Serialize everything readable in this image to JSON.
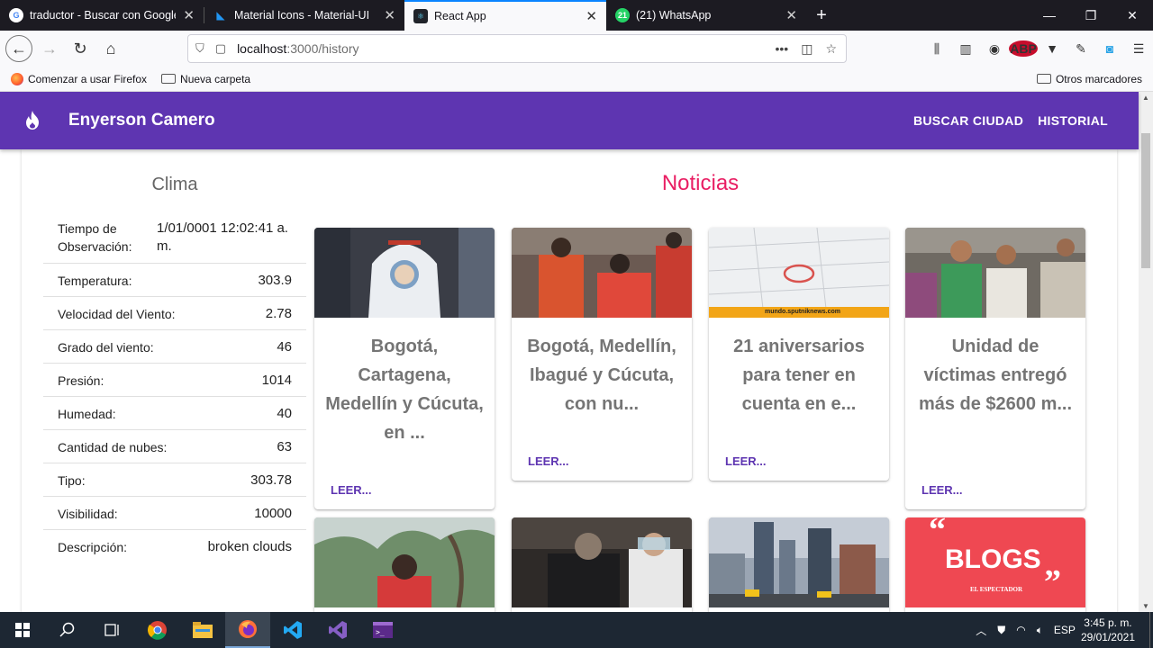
{
  "browser": {
    "tabs": [
      {
        "title": "traductor - Buscar con Google",
        "icon": "google-icon"
      },
      {
        "title": "Material Icons - Material-UI",
        "icon": "material-ui-icon"
      },
      {
        "title": "React App",
        "icon": "react-icon"
      },
      {
        "title": "(21) WhatsApp",
        "icon": "whatsapp-icon",
        "badge": "21"
      }
    ],
    "url_host": "localhost",
    "url_path": ":3000/history",
    "bookmarks": [
      {
        "label": "Comenzar a usar Firefox",
        "icon": "firefox-icon"
      },
      {
        "label": "Nueva carpeta",
        "icon": "folder-icon"
      }
    ],
    "other_bookmarks": "Otros marcadores",
    "abp_label": "ABP"
  },
  "app": {
    "brand": "Enyerson Camero",
    "nav": [
      "BUSCAR CIUDAD",
      "HISTORIAL"
    ],
    "accent": "#5e35b1",
    "news_color": "#e91e63"
  },
  "weather": {
    "title": "Clima",
    "rows": [
      {
        "label": "Tiempo de Observación:",
        "value": "1/01/0001 12:02:41 a. m."
      },
      {
        "label": "Temperatura:",
        "value": "303.9"
      },
      {
        "label": "Velocidad del Viento:",
        "value": "2.78"
      },
      {
        "label": "Grado del viento:",
        "value": "46"
      },
      {
        "label": "Presión:",
        "value": "1014"
      },
      {
        "label": "Humedad:",
        "value": "40"
      },
      {
        "label": "Cantidad de nubes:",
        "value": "63"
      },
      {
        "label": "Tipo:",
        "value": "303.78"
      },
      {
        "label": "Visibilidad:",
        "value": "10000"
      },
      {
        "label": "Descripción:",
        "value": "broken clouds"
      }
    ]
  },
  "news": {
    "title": "Noticias",
    "cards": [
      {
        "title": "Bogotá, Cartagena, Medellín y Cúcuta, en ...",
        "action": "LEER..."
      },
      {
        "title": "Bogotá, Medellín, Ibagué y Cúcuta, con nu...",
        "action": "LEER..."
      },
      {
        "title": "21 aniversarios para tener en cuenta en e...",
        "action": "LEER...",
        "image_caption": "mundo.sputniknews.com"
      },
      {
        "title": "Unidad de víctimas entregó más de $2600 m...",
        "action": "LEER..."
      },
      {
        "title": "",
        "action": ""
      },
      {
        "title": "",
        "action": ""
      },
      {
        "title": "",
        "action": ""
      },
      {
        "title": "",
        "action": "",
        "image_text": "BLOGS",
        "image_caption": "EL ESPECTADOR"
      }
    ]
  },
  "taskbar": {
    "lang": "ESP",
    "time": "3:45 p. m.",
    "date": "29/01/2021"
  }
}
